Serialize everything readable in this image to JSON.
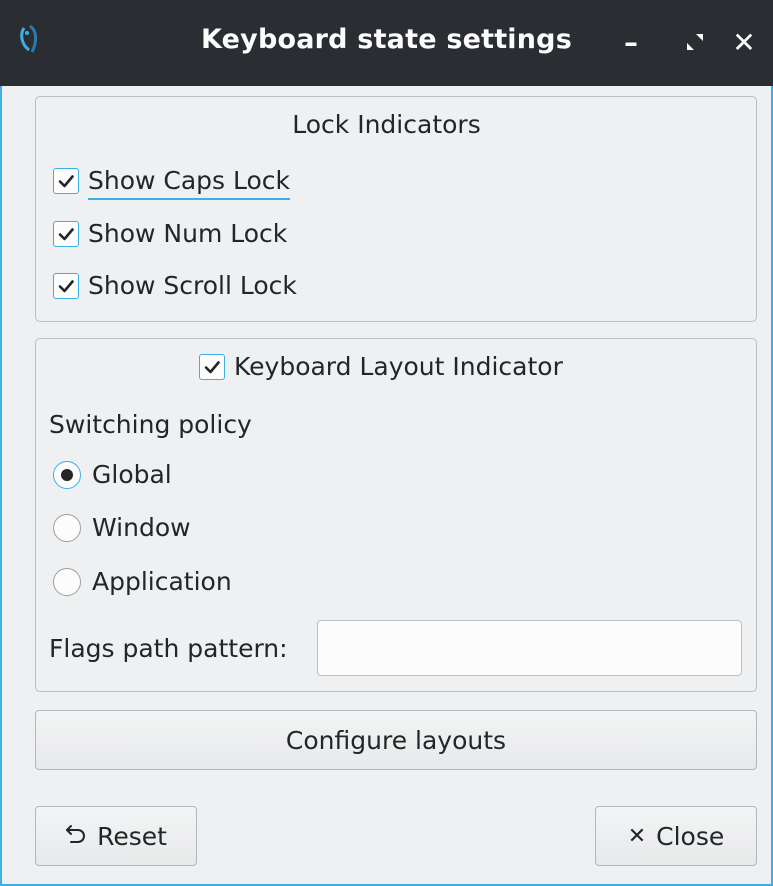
{
  "window": {
    "title": "Keyboard state settings"
  },
  "lock_indicators": {
    "title": "Lock Indicators",
    "items": [
      {
        "label": "Show Caps Lock",
        "checked": true
      },
      {
        "label": "Show Num Lock",
        "checked": true
      },
      {
        "label": "Show Scroll Lock",
        "checked": true
      }
    ]
  },
  "layout_indicator": {
    "label": "Keyboard Layout Indicator",
    "checked": true,
    "switching_policy_label": "Switching policy",
    "options": [
      {
        "label": "Global",
        "selected": true
      },
      {
        "label": "Window",
        "selected": false
      },
      {
        "label": "Application",
        "selected": false
      }
    ],
    "flags_label": "Flags path pattern:",
    "flags_value": ""
  },
  "buttons": {
    "configure": "Configure layouts",
    "reset": "Reset",
    "close": "Close"
  },
  "icons": {
    "app": "lxqt-logo-icon",
    "minimize": "minimize-icon",
    "maximize": "maximize-icon",
    "close": "close-icon",
    "reset": "undo-icon",
    "close_button": "close-x-icon"
  },
  "colors": {
    "accent": "#3daee9",
    "titlebar": "#2a2e32",
    "window_bg": "#eff0f1"
  }
}
